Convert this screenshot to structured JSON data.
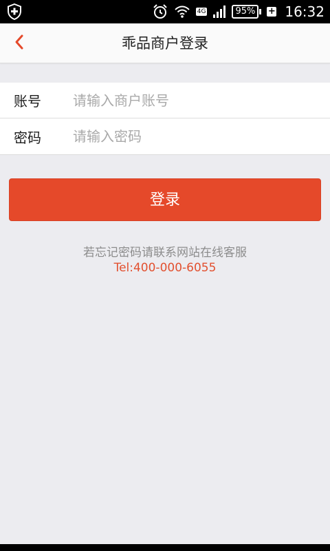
{
  "status_bar": {
    "network": "4G",
    "battery": "95%",
    "charging": "+",
    "time": "16:32"
  },
  "header": {
    "title": "乖品商户登录",
    "back_icon": "chevron-left-icon"
  },
  "form": {
    "account_label": "账号",
    "account_placeholder": "请输入商户账号",
    "account_value": "",
    "password_label": "密码",
    "password_placeholder": "请输入密码",
    "password_value": ""
  },
  "login_button": "登录",
  "hint": {
    "forgot_text": "若忘记密码请联系网站在线客服",
    "phone": "Tel:400-000-6055"
  },
  "colors": {
    "accent": "#e5492a",
    "background": "#ececf0",
    "phone_text": "#e2502f"
  }
}
